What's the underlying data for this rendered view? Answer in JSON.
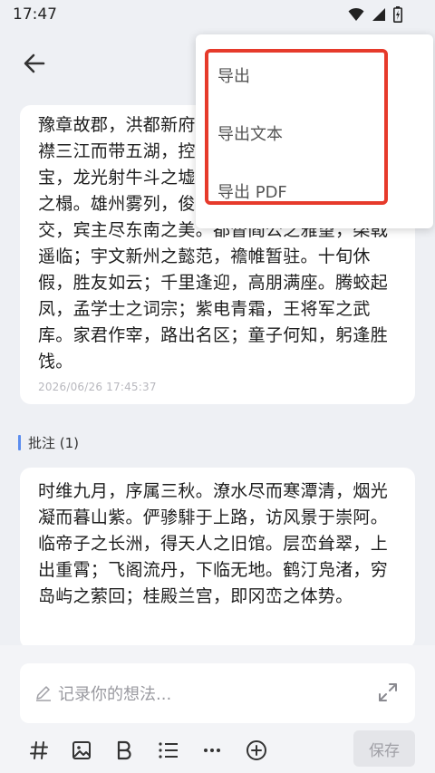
{
  "status": {
    "time": "17:47"
  },
  "colors": {
    "highlight": "#e63a2b",
    "accent": "#5b8def"
  },
  "note": {
    "text": "豫章故郡，洪都新府。星分翼轸，地接衡庐。襟三江而带五湖，控蛮荆而引瓯越。物华天宝，龙光射牛斗之墟；人杰地灵，徐孺下陈蕃之榻。雄州雾列，俊采星驰。台隍枕夷夏之交，宾主尽东南之美。都督阎公之雅望，棨戟遥临；宇文新州之懿范，襜帷暂驻。十旬休假，胜友如云；千里逢迎，高朋满座。腾蛟起凤，孟学士之词宗；紫电青霜，王将军之武库。家君作宰，路出名区；童子何知，躬逢胜饯。",
    "date": "2026/06/26 17:45:37"
  },
  "annotations": {
    "label": "批注 (1)",
    "items": [
      {
        "text": "时维九月，序属三秋。潦水尽而寒潭清，烟光凝而暮山紫。俨骖騑于上路，访风景于崇阿。临帝子之长洲，得天人之旧馆。层峦耸翠，上出重霄；飞阁流丹，下临无地。鹤汀凫渚，穷岛屿之萦回；桂殿兰宫，即冈峦之体势。"
      }
    ]
  },
  "menu": {
    "items": [
      {
        "label": "导出"
      },
      {
        "label": "导出文本"
      },
      {
        "label": "导出 PDF"
      }
    ]
  },
  "editor": {
    "placeholder": "记录你的想法...",
    "save_label": "保存",
    "toolbar_icons": [
      "hash-icon",
      "image-icon",
      "bold-icon",
      "list-icon",
      "more-icon",
      "add-circle-icon"
    ]
  }
}
